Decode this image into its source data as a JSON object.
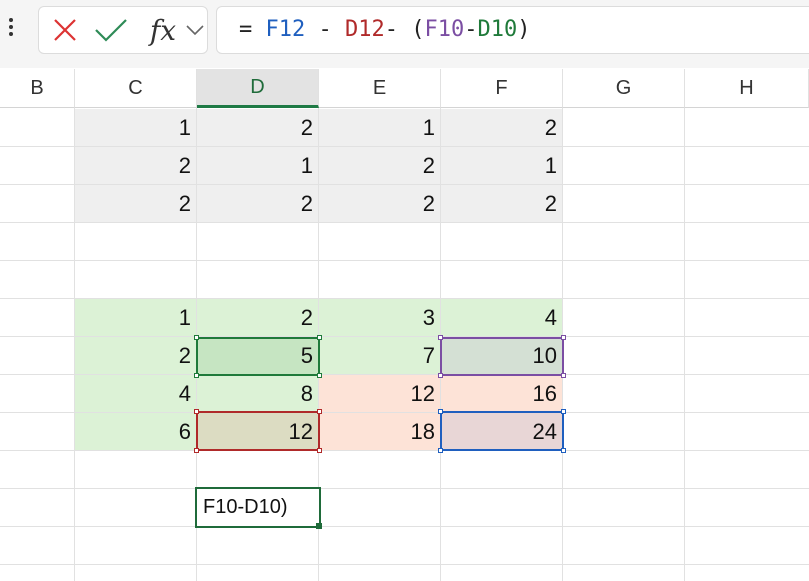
{
  "formula_bar": {
    "menu_icon": "vertical-dots-icon",
    "cancel_icon": "close-x-icon",
    "confirm_icon": "checkmark-icon",
    "fx_label": "fx",
    "expand_icon": "chevron-down-icon",
    "formula_tokens": [
      {
        "text": "= ",
        "color": "#222222"
      },
      {
        "text": "F12",
        "color": "#1f5fbf"
      },
      {
        "text": " - ",
        "color": "#222222"
      },
      {
        "text": "D12",
        "color": "#b02a2a"
      },
      {
        "text": "- (",
        "color": "#222222"
      },
      {
        "text": "F10",
        "color": "#7b4ea3"
      },
      {
        "text": "-",
        "color": "#222222"
      },
      {
        "text": "D10",
        "color": "#1f7a3a"
      },
      {
        "text": ")",
        "color": "#222222"
      }
    ]
  },
  "columns": [
    "B",
    "C",
    "D",
    "E",
    "F",
    "G",
    "H"
  ],
  "selected_column": "D",
  "table_top": {
    "rows": [
      [
        "1",
        "2",
        "1",
        "2"
      ],
      [
        "2",
        "1",
        "2",
        "1"
      ],
      [
        "2",
        "2",
        "2",
        "2"
      ]
    ]
  },
  "table_bottom": {
    "rows": [
      [
        "1",
        "2",
        "3",
        "4"
      ],
      [
        "2",
        "5",
        "7",
        "10"
      ],
      [
        "4",
        "8",
        "12",
        "16"
      ],
      [
        "6",
        "12",
        "18",
        "24"
      ]
    ]
  },
  "edit_cell": {
    "text": "F10-D10)"
  },
  "colors": {
    "gray_fill": "#efefef",
    "green_fill": "#dcf2d6",
    "salmon_fill": "#fde3d7",
    "ref_green": "#1f7a3a",
    "ref_purple": "#7b4ea3",
    "ref_red": "#b02a2a",
    "ref_blue": "#1f5fbf"
  }
}
